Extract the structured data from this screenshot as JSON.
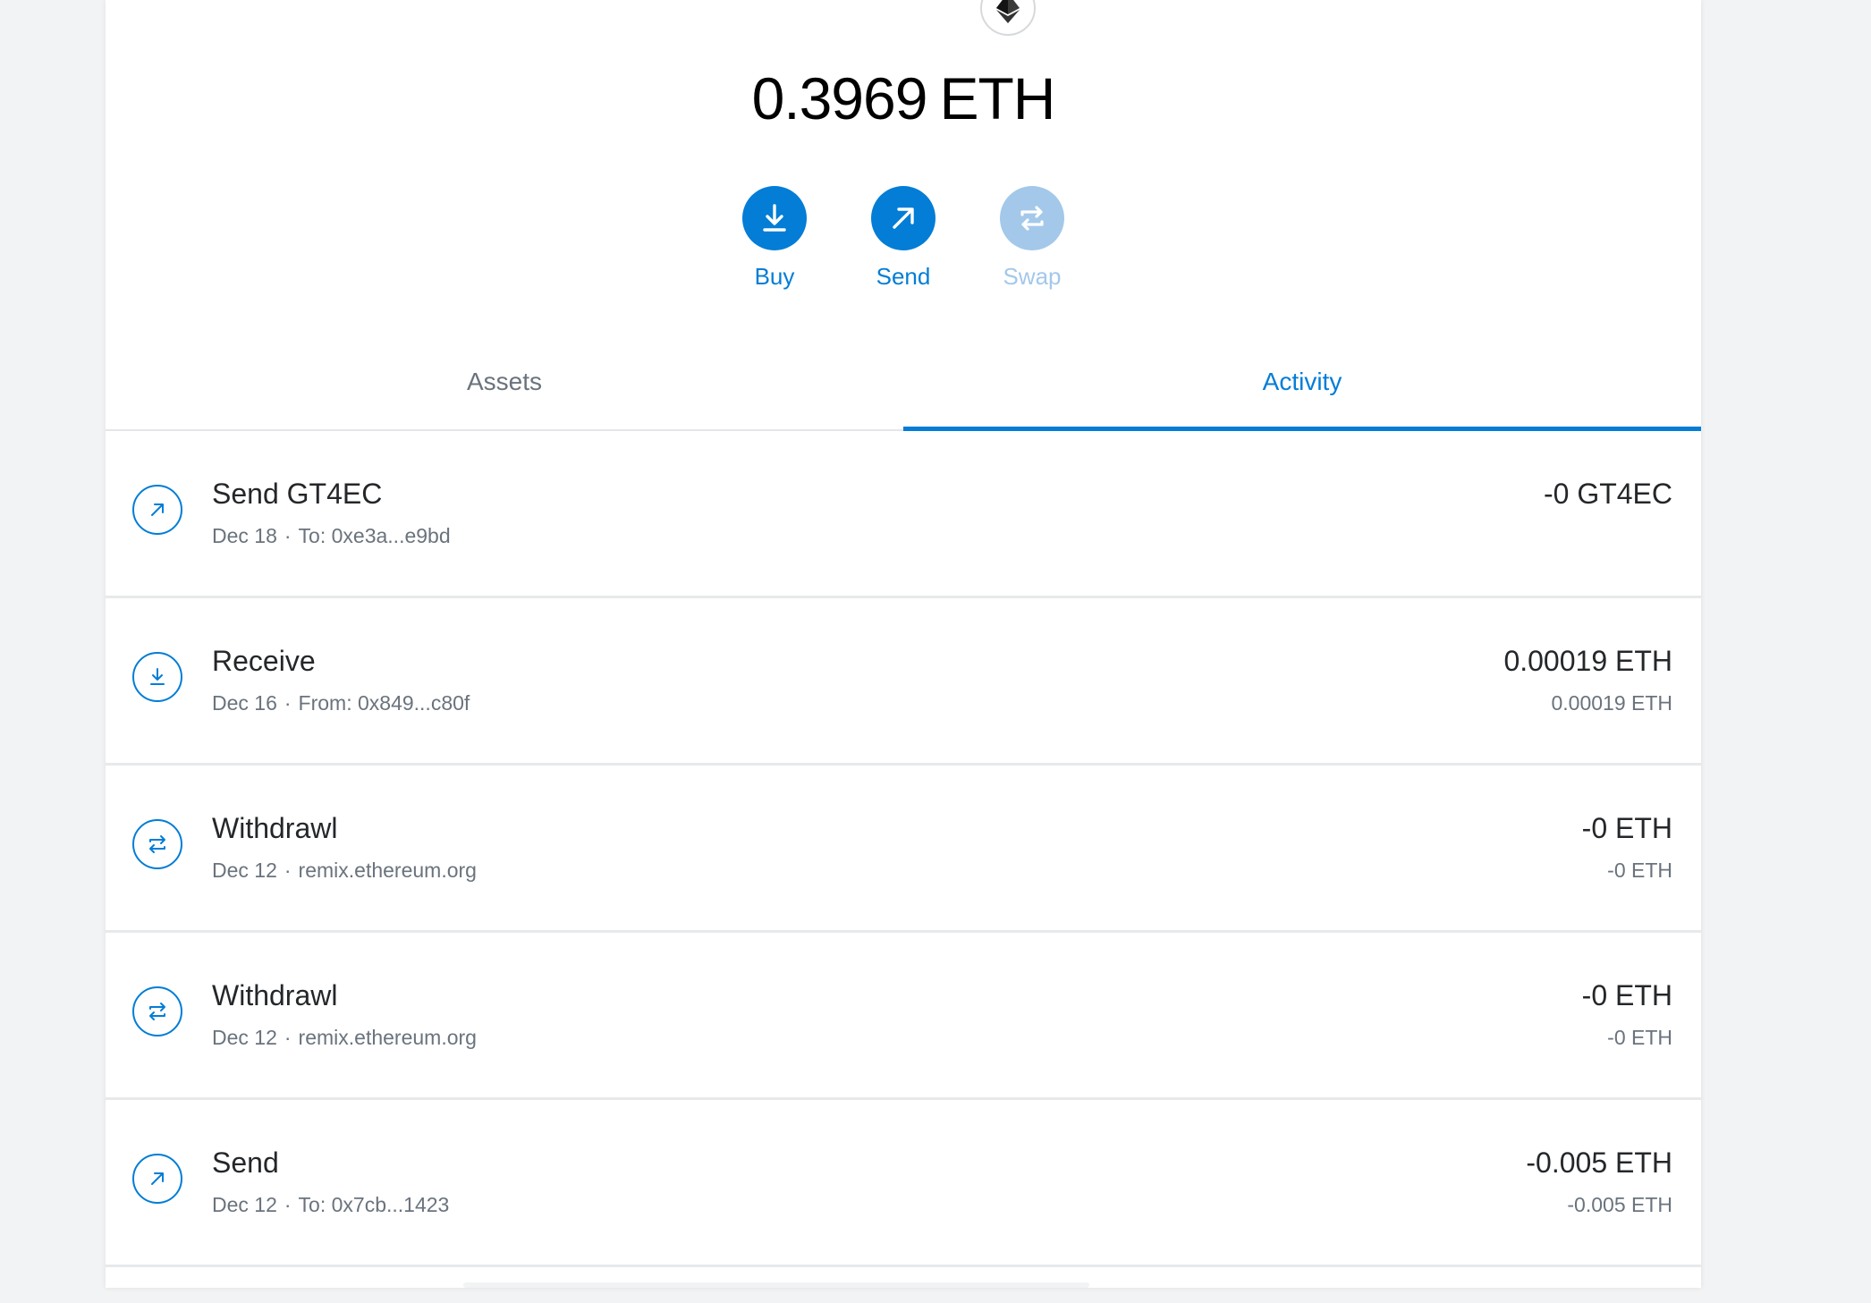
{
  "balance": {
    "value": "0.3969",
    "unit": "ETH"
  },
  "actions": {
    "buy": "Buy",
    "send": "Send",
    "swap": "Swap"
  },
  "tabs": {
    "assets": "Assets",
    "activity": "Activity",
    "active": "Activity"
  },
  "transactions": [
    {
      "type": "send",
      "icon": "arrow-up-right-icon",
      "title": "Send GT4EC",
      "date": "Dec 18",
      "detail": "To: 0xe3a...e9bd",
      "amount": "-0 GT4EC",
      "amount_secondary": ""
    },
    {
      "type": "receive",
      "icon": "download-icon",
      "title": "Receive",
      "date": "Dec 16",
      "detail": "From: 0x849...c80f",
      "amount": "0.00019 ETH",
      "amount_secondary": "0.00019 ETH"
    },
    {
      "type": "interaction",
      "icon": "swap-arrows-icon",
      "title": "Withdrawl",
      "date": "Dec 12",
      "detail": "remix.ethereum.org",
      "amount": "-0 ETH",
      "amount_secondary": "-0 ETH"
    },
    {
      "type": "interaction",
      "icon": "swap-arrows-icon",
      "title": "Withdrawl",
      "date": "Dec 12",
      "detail": "remix.ethereum.org",
      "amount": "-0 ETH",
      "amount_secondary": "-0 ETH"
    },
    {
      "type": "send",
      "icon": "arrow-up-right-icon",
      "title": "Send",
      "date": "Dec 12",
      "detail": "To: 0x7cb...1423",
      "amount": "-0.005 ETH",
      "amount_secondary": "-0.005 ETH"
    }
  ],
  "separator": "·",
  "colors": {
    "accent": "#037dd6",
    "accent_disabled": "#a3c8ea",
    "text_primary": "#24272a",
    "text_secondary": "#6a737d",
    "background": "#f2f3f4"
  }
}
